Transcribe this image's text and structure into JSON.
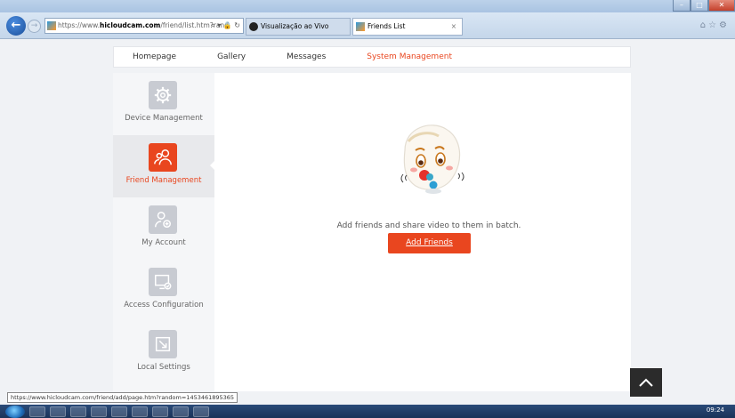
{
  "browser": {
    "address_scheme": "https://www.",
    "address_domain": "hicloudcam.com",
    "address_path": "/friend/list.htm?rand",
    "tabs": [
      {
        "label": "Visualização ao Vivo"
      },
      {
        "label": "Friends List"
      }
    ],
    "tab_close": "×",
    "status_url": "https://www.hicloudcam.com/friend/add/page.htm?random=1453461895365"
  },
  "topnav": {
    "items": [
      {
        "label": "Homepage"
      },
      {
        "label": "Gallery"
      },
      {
        "label": "Messages"
      },
      {
        "label": "System Management",
        "active": true
      }
    ]
  },
  "sidebar": {
    "items": [
      {
        "label": "Device Management",
        "icon": "gear-icon"
      },
      {
        "label": "Friend Management",
        "icon": "users-icon",
        "selected": true
      },
      {
        "label": "My Account",
        "icon": "account-icon"
      },
      {
        "label": "Access Configuration",
        "icon": "monitor-check-icon"
      },
      {
        "label": "Local Settings",
        "icon": "local-settings-icon"
      }
    ]
  },
  "content": {
    "empty_message": "Add friends and share video to them in batch.",
    "add_button": "Add Friends"
  },
  "taskbar": {
    "clock": "09:24"
  },
  "colors": {
    "accent": "#e9461f",
    "sidebar_bg": "#f5f6f8",
    "page_bg": "#f0f2f5"
  }
}
